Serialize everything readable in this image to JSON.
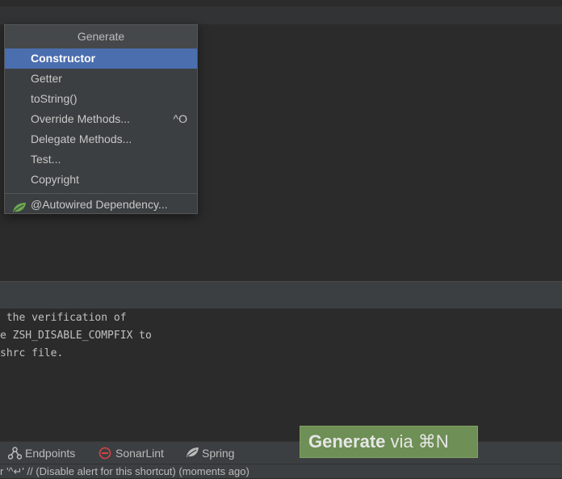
{
  "popup": {
    "title": "Generate",
    "items": [
      {
        "label": "Constructor",
        "shortcut": "",
        "selected": true
      },
      {
        "label": "Getter",
        "shortcut": ""
      },
      {
        "label": "toString()",
        "shortcut": ""
      },
      {
        "label": "Override Methods...",
        "shortcut": "^O"
      },
      {
        "label": "Delegate Methods...",
        "shortcut": ""
      },
      {
        "label": "Test...",
        "shortcut": ""
      },
      {
        "label": "Copyright",
        "shortcut": ""
      }
    ],
    "spring_item": {
      "label": "@Autowired Dependency...",
      "icon": "spring-leaf-icon"
    }
  },
  "terminal": {
    "lines": [
      " the verification of",
      "e ZSH_DISABLE_COMPFIX to",
      "shrc file."
    ]
  },
  "toolbar": {
    "endpoints": "Endpoints",
    "sonarlint": "SonarLint",
    "spring": "Spring"
  },
  "status": {
    "text": "r '^↵' // (Disable alert for this shortcut) (moments ago)"
  },
  "promo": {
    "bold": "Generate",
    "rest": " via ⌘N"
  },
  "colors": {
    "selection": "#4b6eaf",
    "promo_bg": "#6e8f55",
    "spring_green": "#6aa84f",
    "sonarlint_red": "#d14545"
  }
}
